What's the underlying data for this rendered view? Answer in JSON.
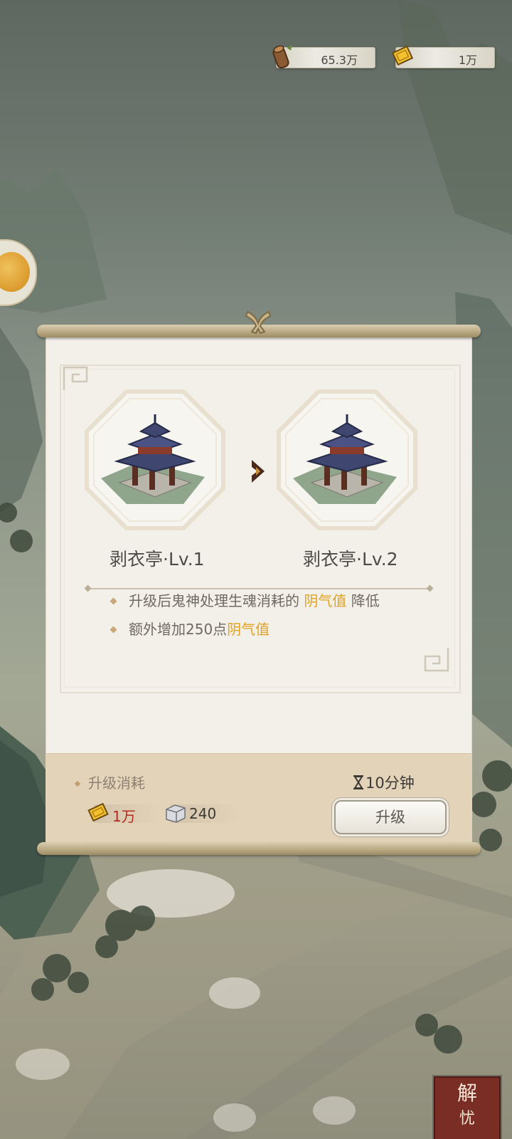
{
  "resources": {
    "wood": {
      "value": "65.3万",
      "icon": "wood-log-icon"
    },
    "gold": {
      "value": "1万",
      "icon": "gold-ticket-icon"
    }
  },
  "side_button": {
    "icon": "coin-icon"
  },
  "dialog": {
    "current": {
      "name": "剥衣亭·Lv.1"
    },
    "next": {
      "name": "剥衣亭·Lv.2"
    },
    "effects": [
      {
        "prefix": "升级后鬼神处理生魂消耗的 ",
        "highlight": "阴气值",
        "suffix": " 降低"
      },
      {
        "prefix": "额外增加250点",
        "highlight": "阴气值",
        "suffix": ""
      }
    ],
    "cost": {
      "title": "升级消耗",
      "time": "10分钟",
      "gold": "1万",
      "stone": "240"
    },
    "upgrade_label": "升级"
  },
  "seal": {
    "char1": "解",
    "char2": "忧"
  },
  "colors": {
    "highlight": "#e0a21f",
    "cost_red": "#b52a20",
    "paper": "#f3f0ea",
    "cost_panel": "#e2d3b9"
  }
}
